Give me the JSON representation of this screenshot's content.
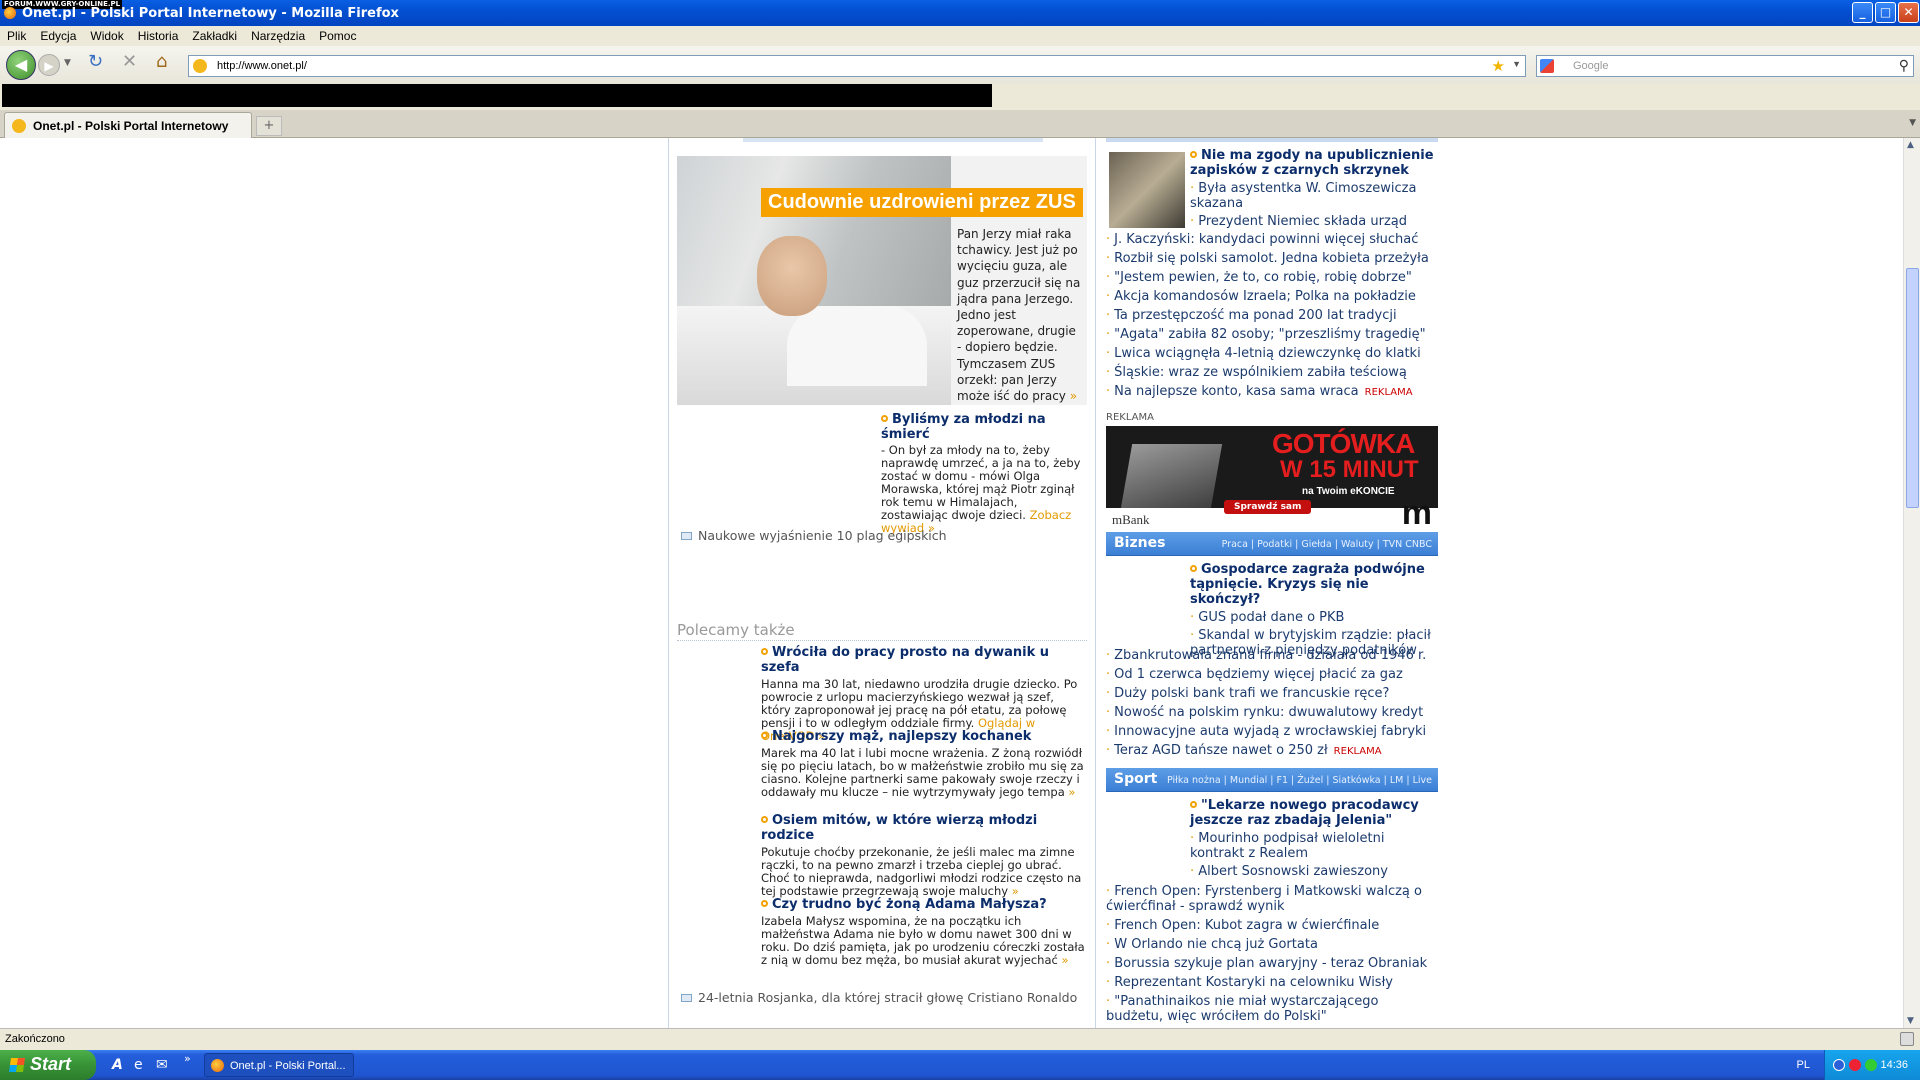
{
  "window": {
    "watermark": "FORUM.WWW.GRY-ONLINE.PL",
    "title": "Onet.pl - Polski Portal Internetowy - Mozilla Firefox",
    "buttons": {
      "minimize": "_",
      "maximize": "□",
      "close": "✕"
    }
  },
  "menu": [
    "Plik",
    "Edycja",
    "Widok",
    "Historia",
    "Zakładki",
    "Narzędzia",
    "Pomoc"
  ],
  "nav": {
    "back_icon": "back-arrow-icon",
    "forward_icon": "forward-arrow-icon",
    "url": "http://www.onet.pl/",
    "search_placeholder": "Google"
  },
  "tabs": [
    {
      "label": "Onet.pl - Polski Portal Internetowy"
    }
  ],
  "main_story": {
    "headline": "Cudownie uzdrowieni przez ZUS",
    "lead": "Pan Jerzy miał raka tchawicy. Jest już po wycięciu guza, ale guz przerzucił się na jądra pana Jerzego. Jedno jest zoperowane, drugie - dopiero będzie. Tymczasem ZUS orzekł: pan Jerzy może iść do pracy",
    "more": "»"
  },
  "story2": {
    "title": "Byliśmy za młodzi na śmierć",
    "body": "- On był za młody na to, żeby naprawdę umrzeć, a ja na to, żeby zostać w domu - mówi Olga Morawska, której mąż Piotr zginął rok temu w Himalajach, zostawiając dwoje dzieci.",
    "more": "Zobacz wywiad »"
  },
  "mail_link1": "Naukowe wyjaśnienie 10 plag egipskich",
  "recommended": {
    "header": "Polecamy także",
    "items": [
      {
        "title": "Wróciła do pracy prosto na dywanik u szefa",
        "body": "Hanna ma 30 lat, niedawno urodziła drugie dziecko. Po powrocie z urlopu macierzyńskiego wezwał ją szef, który zaproponował jej pracę na pół etatu, za połowę pensji i to w odległym oddziale firmy.",
        "more": "Oglądaj w OnetVOD »"
      },
      {
        "title": "Najgorszy mąż, najlepszy kochanek",
        "body": "Marek ma 40 lat i lubi mocne wrażenia. Z żoną rozwiódł się po pięciu latach, bo w małżeństwie zrobiło mu się za ciasno. Kolejne partnerki same pakowały swoje rzeczy i oddawały mu klucze – nie wytrzymywały jego tempa",
        "more": "»"
      },
      {
        "title": "Osiem mitów, w które wierzą młodzi rodzice",
        "body": "Pokutuje choćby przekonanie, że jeśli malec ma zimne rączki, to na pewno zmarzł i trzeba cieplej go ubrać. Choć to nieprawda, nadgorliwi młodzi rodzice często na tej podstawie przegrzewają swoje maluchy",
        "more": "»"
      },
      {
        "title": "Czy trudno być żoną Adama Małysza?",
        "body": "Izabela Małysz wspomina, że na początku ich małżeństwa Adama nie było w domu nawet 300 dni w roku. Do dziś pamięta, jak po urodzeniu córeczki została z nią w domu bez męża, bo musiał akurat wyjechać",
        "more": "»"
      }
    ]
  },
  "mail_link2": "24-letnia Rosjanka, dla której stracił głowę Cristiano Ronaldo",
  "news": {
    "top_main": "Nie ma zgody na upublicznienie zapisków z czarnych skrzynek",
    "top_subs": [
      "Była asystentka W. Cimoszewicza skazana",
      "Prezydent Niemiec składa urząd"
    ],
    "list": [
      "J. Kaczyński: kandydaci powinni więcej słuchać",
      "Rozbił się polski samolot. Jedna kobieta przeżyła",
      "\"Jestem pewien, że to, co robię, robię dobrze\"",
      "Akcja komandosów Izraela; Polka na pokładzie",
      "Ta przestępczość ma ponad 200 lat tradycji",
      "\"Agata\" zabiła 82 osoby; \"przeszliśmy tragedię\"",
      "Lwica wciągnęła 4-letnią dziewczynkę do klatki",
      "Śląskie: wraz ze wspólnikiem zabiła teściową"
    ],
    "ad_item": "Na najlepsze konto, kasa sama wraca",
    "ad_tag": "REKLAMA"
  },
  "ad": {
    "label": "REKLAMA",
    "line1": "GOTÓWKA",
    "line2": "W 15 MINUT",
    "line3": "na Twoim eKONCIE",
    "cta": "Sprawdź sam",
    "brand": "mBank",
    "logo": "m"
  },
  "biznes": {
    "header": "Biznes",
    "links": "Praca | Podatki | Giełda | Waluty | TVN CNBC",
    "main": "Gospodarce zagraża podwójne tąpnięcie. Kryzys się nie skończył?",
    "subs": [
      "GUS podał dane o PKB",
      "Skandal w brytyjskim rządzie: płacił partnerowi z pieniędzy podatników"
    ],
    "list": [
      "Zbankrutowała znana firma - działała od 1946 r.",
      "Od 1 czerwca będziemy więcej płacić za gaz",
      "Duży polski bank trafi we francuskie ręce?",
      "Nowość na polskim rynku: dwuwalutowy kredyt",
      "Innowacyjne auta wyjadą z wrocławskiej fabryki"
    ],
    "ad_item": "Teraz AGD tańsze nawet o 250 zł",
    "ad_tag": "REKLAMA"
  },
  "sport": {
    "header": "Sport",
    "links": "Piłka nożna | Mundial | F1 | Żużel | Siatkówka | LM | Live",
    "main": "\"Lekarze nowego pracodawcy jeszcze raz zbadają Jelenia\"",
    "subs": [
      "Mourinho podpisał wieloletni kontrakt z Realem",
      "Albert Sosnowski zawieszony"
    ],
    "list": [
      "French Open: Fyrstenberg i Matkowski walczą o ćwierćfinał - sprawdź wynik",
      "French Open: Kubot zagra w ćwierćfinale",
      "W Orlando nie chcą już Gortata",
      "Borussia szykuje plan awaryjny - teraz Obraniak",
      "Reprezentant Kostaryki na celowniku Wisły",
      "\"Panathinaikos nie miał wystarczającego budżetu, więc wróciłem do Polski\""
    ]
  },
  "status": {
    "text": "Zakończono"
  },
  "taskbar": {
    "start": "Start",
    "item": "Onet.pl - Polski Portal...",
    "lang": "PL",
    "clock": "14:36"
  },
  "colors": {
    "accent": "#f6a100",
    "link": "#0c2d6b",
    "section": "#3b7fd6"
  }
}
